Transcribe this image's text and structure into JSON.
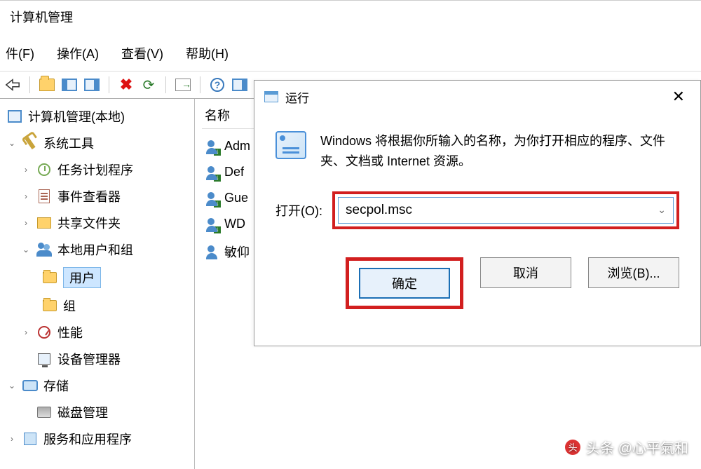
{
  "window": {
    "title": "计算机管理"
  },
  "menu": {
    "file": "件(F)",
    "action": "操作(A)",
    "view": "查看(V)",
    "help": "帮助(H)"
  },
  "sidebar": {
    "root": "计算机管理(本地)",
    "systools": "系统工具",
    "tasksched": "任务计划程序",
    "eventviewer": "事件查看器",
    "sharedfolders": "共享文件夹",
    "localusers": "本地用户和组",
    "users": "用户",
    "groups": "组",
    "performance": "性能",
    "devmgr": "设备管理器",
    "storage": "存储",
    "diskmgmt": "磁盘管理",
    "services": "服务和应用程序"
  },
  "content": {
    "header": "名称",
    "items": [
      "Adm",
      "Def",
      "Gue",
      "WD",
      "敏仰"
    ]
  },
  "run": {
    "title": "运行",
    "close": "✕",
    "description": "Windows 将根据你所输入的名称，为你打开相应的程序、文件夹、文档或 Internet 资源。",
    "open_label": "打开(O):",
    "input_value": "secpol.msc",
    "ok": "确定",
    "cancel": "取消",
    "browse": "浏览(B)..."
  },
  "watermark": "头条 @心平氣和"
}
